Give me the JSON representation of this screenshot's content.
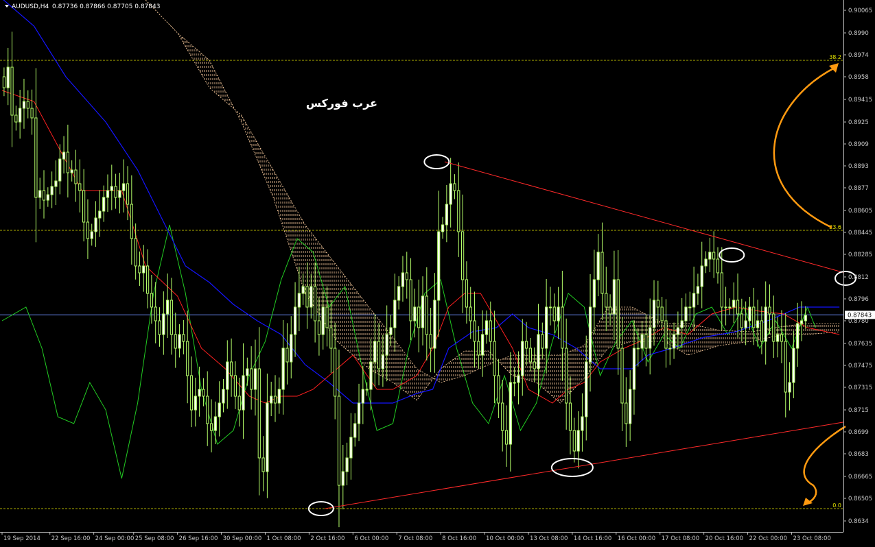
{
  "window": {
    "symbol_label": "AUDUSD,H4",
    "ohlc_text": "0.87736 0.87866 0.87705 0.87843"
  },
  "watermark": "عرب فوركس",
  "colors": {
    "background": "#000000",
    "candle": "#b6ff6a",
    "price_line": "#6f8fff",
    "tenkan": "#ff2020",
    "kijun": "#1414ff",
    "chikou": "#22cc22",
    "kumo": "#ffd0a0",
    "fib": "#e6e600",
    "trendline": "#ff2a2a",
    "circle": "#ffffff",
    "arrow": "#ff9a10",
    "axis_text": "#c8c8c8"
  },
  "chart_data": {
    "type": "line",
    "ylim": [
      0.8626,
      0.9014
    ],
    "x_range_bars": [
      0,
      211
    ],
    "price_ticks": [
      0.90065,
      0.899,
      0.8974,
      0.8958,
      0.89415,
      0.8925,
      0.8909,
      0.8893,
      0.8877,
      0.88605,
      0.88445,
      0.88285,
      0.8812,
      0.8796,
      0.878,
      0.87635,
      0.87475,
      0.87315,
      0.8715,
      0.8699,
      0.8683,
      0.86665,
      0.86505,
      0.8634
    ],
    "date_labels": [
      {
        "bar": 0,
        "label": "19 Sep 2014"
      },
      {
        "bar": 12,
        "label": "22 Sep 16:00"
      },
      {
        "bar": 23,
        "label": "24 Sep 00:00"
      },
      {
        "bar": 33,
        "label": "25 Sep 08:00"
      },
      {
        "bar": 44,
        "label": "26 Sep 16:00"
      },
      {
        "bar": 55,
        "label": "30 Sep 00:00"
      },
      {
        "bar": 66,
        "label": "1 Oct 08:00"
      },
      {
        "bar": 77,
        "label": "2 Oct 16:00"
      },
      {
        "bar": 88,
        "label": "6 Oct 00:00"
      },
      {
        "bar": 99,
        "label": "7 Oct 08:00"
      },
      {
        "bar": 110,
        "label": "8 Oct 16:00"
      },
      {
        "bar": 121,
        "label": "10 Oct 00:00"
      },
      {
        "bar": 132,
        "label": "13 Oct 08:00"
      },
      {
        "bar": 143,
        "label": "14 Oct 16:00"
      },
      {
        "bar": 154,
        "label": "16 Oct 00:00"
      },
      {
        "bar": 165,
        "label": "17 Oct 08:00"
      },
      {
        "bar": 176,
        "label": "20 Oct 16:00"
      },
      {
        "bar": 187,
        "label": "22 Oct 00:00"
      },
      {
        "bar": 198,
        "label": "23 Oct 08:00"
      }
    ],
    "current_price": 0.87843,
    "current_price_label": "0.87843",
    "fib_levels": [
      {
        "label": "38.2",
        "price": 0.897
      },
      {
        "label": "23.6",
        "price": 0.8846
      },
      {
        "label": "0.0",
        "price": 0.8643
      }
    ],
    "candles_close": [
      0.895,
      0.8965,
      0.893,
      0.8925,
      0.8935,
      0.894,
      0.8935,
      0.8928,
      0.887,
      0.8875,
      0.8868,
      0.8872,
      0.8878,
      0.8882,
      0.8898,
      0.8903,
      0.8888,
      0.889,
      0.888,
      0.8875,
      0.8852,
      0.884,
      0.8845,
      0.8855,
      0.886,
      0.887,
      0.8875,
      0.8878,
      0.887,
      0.8875,
      0.888,
      0.8865,
      0.884,
      0.882,
      0.8815,
      0.882,
      0.88,
      0.879,
      0.878,
      0.877,
      0.8785,
      0.8795,
      0.877,
      0.876,
      0.877,
      0.8765,
      0.874,
      0.8715,
      0.8725,
      0.873,
      0.8725,
      0.8705,
      0.87,
      0.871,
      0.872,
      0.873,
      0.875,
      0.874,
      0.8725,
      0.8715,
      0.874,
      0.8745,
      0.873,
      0.8745,
      0.868,
      0.867,
      0.872,
      0.8725,
      0.872,
      0.873,
      0.876,
      0.875,
      0.877,
      0.879,
      0.88,
      0.8805,
      0.879,
      0.8805,
      0.878,
      0.877,
      0.879,
      0.8775,
      0.876,
      0.8725,
      0.866,
      0.867,
      0.868,
      0.8695,
      0.8705,
      0.872,
      0.873,
      0.873,
      0.875,
      0.8765,
      0.8745,
      0.8755,
      0.877,
      0.8775,
      0.8795,
      0.8805,
      0.8815,
      0.881,
      0.878,
      0.879,
      0.8775,
      0.8798,
      0.877,
      0.876,
      0.8795,
      0.8845,
      0.885,
      0.8865,
      0.888,
      0.8875,
      0.8845,
      0.881,
      0.879,
      0.878,
      0.8765,
      0.8755,
      0.877,
      0.878,
      0.8765,
      0.874,
      0.872,
      0.87,
      0.869,
      0.8735,
      0.8735,
      0.874,
      0.8765,
      0.876,
      0.875,
      0.8745,
      0.877,
      0.876,
      0.879,
      0.879,
      0.878,
      0.879,
      0.876,
      0.872,
      0.87,
      0.8685,
      0.87,
      0.871,
      0.875,
      0.879,
      0.881,
      0.883,
      0.88,
      0.879,
      0.8785,
      0.881,
      0.876,
      0.872,
      0.8705,
      0.873,
      0.876,
      0.876,
      0.877,
      0.876,
      0.8775,
      0.8795,
      0.879,
      0.878,
      0.876,
      0.876,
      0.877,
      0.8775,
      0.878,
      0.879,
      0.879,
      0.88,
      0.8805,
      0.882,
      0.8825,
      0.883,
      0.8825,
      0.8815,
      0.879,
      0.879,
      0.879,
      0.8795,
      0.8785,
      0.8775,
      0.878,
      0.879,
      0.8775,
      0.878,
      0.8765,
      0.879,
      0.8785,
      0.8765,
      0.877,
      0.8765,
      0.8728,
      0.8735,
      0.876,
      0.8778,
      0.878,
      0.8784
    ],
    "series": [
      {
        "key": "tenkan",
        "points": [
          [
            0,
            0.8948
          ],
          [
            8,
            0.894
          ],
          [
            20,
            0.8875
          ],
          [
            30,
            0.8875
          ],
          [
            36,
            0.882
          ],
          [
            44,
            0.8798
          ],
          [
            50,
            0.876
          ],
          [
            56,
            0.8745
          ],
          [
            62,
            0.8725
          ],
          [
            66,
            0.872
          ],
          [
            70,
            0.8725
          ],
          [
            74,
            0.8725
          ],
          [
            78,
            0.873
          ],
          [
            84,
            0.8745
          ],
          [
            88,
            0.8755
          ],
          [
            94,
            0.873
          ],
          [
            98,
            0.873
          ],
          [
            104,
            0.874
          ],
          [
            108,
            0.876
          ],
          [
            112,
            0.879
          ],
          [
            116,
            0.88
          ],
          [
            120,
            0.88
          ],
          [
            124,
            0.878
          ],
          [
            128,
            0.876
          ],
          [
            132,
            0.873
          ],
          [
            138,
            0.872
          ],
          [
            142,
            0.873
          ],
          [
            146,
            0.8735
          ],
          [
            150,
            0.875
          ],
          [
            156,
            0.876
          ],
          [
            160,
            0.8765
          ],
          [
            166,
            0.8775
          ],
          [
            172,
            0.877
          ],
          [
            178,
            0.8785
          ],
          [
            184,
            0.879
          ],
          [
            190,
            0.8787
          ],
          [
            196,
            0.8785
          ],
          [
            202,
            0.8775
          ],
          [
            210,
            0.877
          ]
        ]
      },
      {
        "key": "kijun",
        "points": [
          [
            0,
            0.9015
          ],
          [
            8,
            0.8995
          ],
          [
            16,
            0.8958
          ],
          [
            26,
            0.8925
          ],
          [
            34,
            0.889
          ],
          [
            40,
            0.8855
          ],
          [
            46,
            0.882
          ],
          [
            52,
            0.8808
          ],
          [
            58,
            0.8792
          ],
          [
            64,
            0.878
          ],
          [
            70,
            0.877
          ],
          [
            76,
            0.8748
          ],
          [
            82,
            0.8735
          ],
          [
            88,
            0.872
          ],
          [
            98,
            0.872
          ],
          [
            104,
            0.8727
          ],
          [
            108,
            0.873
          ],
          [
            112,
            0.876
          ],
          [
            118,
            0.8772
          ],
          [
            124,
            0.8775
          ],
          [
            128,
            0.8785
          ],
          [
            132,
            0.8775
          ],
          [
            138,
            0.877
          ],
          [
            144,
            0.876
          ],
          [
            150,
            0.8745
          ],
          [
            158,
            0.8745
          ],
          [
            162,
            0.8755
          ],
          [
            168,
            0.876
          ],
          [
            176,
            0.8768
          ],
          [
            184,
            0.8772
          ],
          [
            192,
            0.878
          ],
          [
            200,
            0.879
          ],
          [
            210,
            0.879
          ]
        ]
      },
      {
        "key": "chikou",
        "points": [
          [
            0,
            0.878
          ],
          [
            6,
            0.879
          ],
          [
            10,
            0.876
          ],
          [
            14,
            0.871
          ],
          [
            18,
            0.8705
          ],
          [
            22,
            0.8735
          ],
          [
            26,
            0.8715
          ],
          [
            30,
            0.8665
          ],
          [
            34,
            0.872
          ],
          [
            38,
            0.88
          ],
          [
            42,
            0.885
          ],
          [
            46,
            0.88
          ],
          [
            50,
            0.873
          ],
          [
            54,
            0.869
          ],
          [
            58,
            0.87
          ],
          [
            62,
            0.874
          ],
          [
            66,
            0.8765
          ],
          [
            70,
            0.881
          ],
          [
            74,
            0.884
          ],
          [
            78,
            0.883
          ],
          [
            82,
            0.879
          ],
          [
            86,
            0.8805
          ],
          [
            90,
            0.875
          ],
          [
            94,
            0.87
          ],
          [
            98,
            0.8705
          ],
          [
            102,
            0.876
          ],
          [
            106,
            0.88
          ],
          [
            110,
            0.881
          ],
          [
            114,
            0.876
          ],
          [
            118,
            0.872
          ],
          [
            122,
            0.8705
          ],
          [
            126,
            0.874
          ],
          [
            130,
            0.87
          ],
          [
            134,
            0.872
          ],
          [
            138,
            0.8765
          ],
          [
            142,
            0.88
          ],
          [
            146,
            0.879
          ],
          [
            150,
            0.874
          ],
          [
            154,
            0.8765
          ],
          [
            158,
            0.878
          ],
          [
            162,
            0.875
          ],
          [
            166,
            0.877
          ],
          [
            170,
            0.876
          ],
          [
            174,
            0.8785
          ],
          [
            178,
            0.879
          ],
          [
            182,
            0.877
          ],
          [
            186,
            0.879
          ],
          [
            190,
            0.876
          ],
          [
            194,
            0.878
          ],
          [
            198,
            0.876
          ],
          [
            202,
            0.879
          ],
          [
            204,
            0.8775
          ]
        ]
      },
      {
        "key": "kumo_a",
        "points": [
          [
            36,
            0.9014
          ],
          [
            44,
            0.899
          ],
          [
            52,
            0.895
          ],
          [
            60,
            0.893
          ],
          [
            68,
            0.889
          ],
          [
            76,
            0.885
          ],
          [
            84,
            0.882
          ],
          [
            92,
            0.879
          ],
          [
            98,
            0.8768
          ],
          [
            104,
            0.8745
          ],
          [
            110,
            0.8735
          ],
          [
            116,
            0.874
          ],
          [
            122,
            0.8748
          ],
          [
            128,
            0.8755
          ],
          [
            134,
            0.8755
          ],
          [
            140,
            0.8755
          ],
          [
            146,
            0.8762
          ],
          [
            152,
            0.879
          ],
          [
            158,
            0.879
          ],
          [
            166,
            0.8778
          ],
          [
            172,
            0.8778
          ],
          [
            180,
            0.8773
          ],
          [
            188,
            0.8772
          ],
          [
            196,
            0.8776
          ],
          [
            202,
            0.8778
          ],
          [
            210,
            0.8778
          ]
        ]
      },
      {
        "key": "kumo_b",
        "points": [
          [
            36,
            0.9014
          ],
          [
            44,
            0.899
          ],
          [
            52,
            0.897
          ],
          [
            60,
            0.8925
          ],
          [
            68,
            0.887
          ],
          [
            76,
            0.88
          ],
          [
            84,
            0.8765
          ],
          [
            92,
            0.8745
          ],
          [
            98,
            0.8735
          ],
          [
            104,
            0.8722
          ],
          [
            110,
            0.8745
          ],
          [
            116,
            0.8758
          ],
          [
            122,
            0.8758
          ],
          [
            128,
            0.874
          ],
          [
            134,
            0.8735
          ],
          [
            140,
            0.872
          ],
          [
            146,
            0.8738
          ],
          [
            152,
            0.876
          ],
          [
            158,
            0.8765
          ],
          [
            166,
            0.8765
          ],
          [
            172,
            0.8755
          ],
          [
            180,
            0.8762
          ],
          [
            188,
            0.8765
          ],
          [
            196,
            0.877
          ],
          [
            202,
            0.877
          ],
          [
            210,
            0.8772
          ]
        ]
      }
    ],
    "trendlines": [
      {
        "from": [
          111,
          0.8896
        ],
        "to": [
          215,
          0.8812
        ]
      },
      {
        "from": [
          81,
          0.8643
        ],
        "to": [
          215,
          0.8708
        ]
      }
    ],
    "circles": [
      {
        "bar": 109,
        "price": 0.8896
      },
      {
        "bar": 183,
        "price": 0.8828
      },
      {
        "bar": 213,
        "price": 0.8811
      },
      {
        "bar": 143,
        "price": 0.8673
      },
      {
        "bar": 80,
        "price": 0.8643
      }
    ],
    "arrows": [
      {
        "direction": "up",
        "target_price": 0.8968
      },
      {
        "direction": "down",
        "target_price": 0.8645
      }
    ]
  }
}
